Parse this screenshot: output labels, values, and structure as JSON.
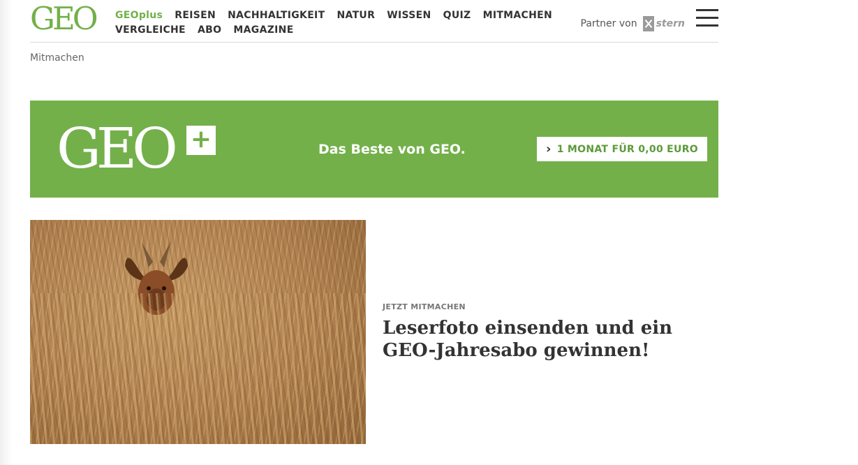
{
  "header": {
    "logo_text": "GEO",
    "nav_items": [
      "GEOplus",
      "REISEN",
      "NACHHALTIGKEIT",
      "NATUR",
      "WISSEN",
      "QUIZ",
      "MITMACHEN",
      "VERGLEICHE",
      "ABO",
      "MAGAZINE"
    ],
    "partner_label": "Partner von",
    "partner_name": "stern"
  },
  "breadcrumb": "Mitmachen",
  "banner": {
    "logo_text": "GEO",
    "plus": "+",
    "tagline": "Das Beste von GEO.",
    "cta_label": "1 MONAT FÜR 0,00 EURO",
    "background_color": "#73b04a"
  },
  "teaser": {
    "kicker": "JETZT MITMACHEN",
    "headline": "Leserfoto einsenden und ein GEO-Jahresabo gewinnen!"
  },
  "colors": {
    "brand_green": "#73b04a",
    "text": "#333333"
  }
}
